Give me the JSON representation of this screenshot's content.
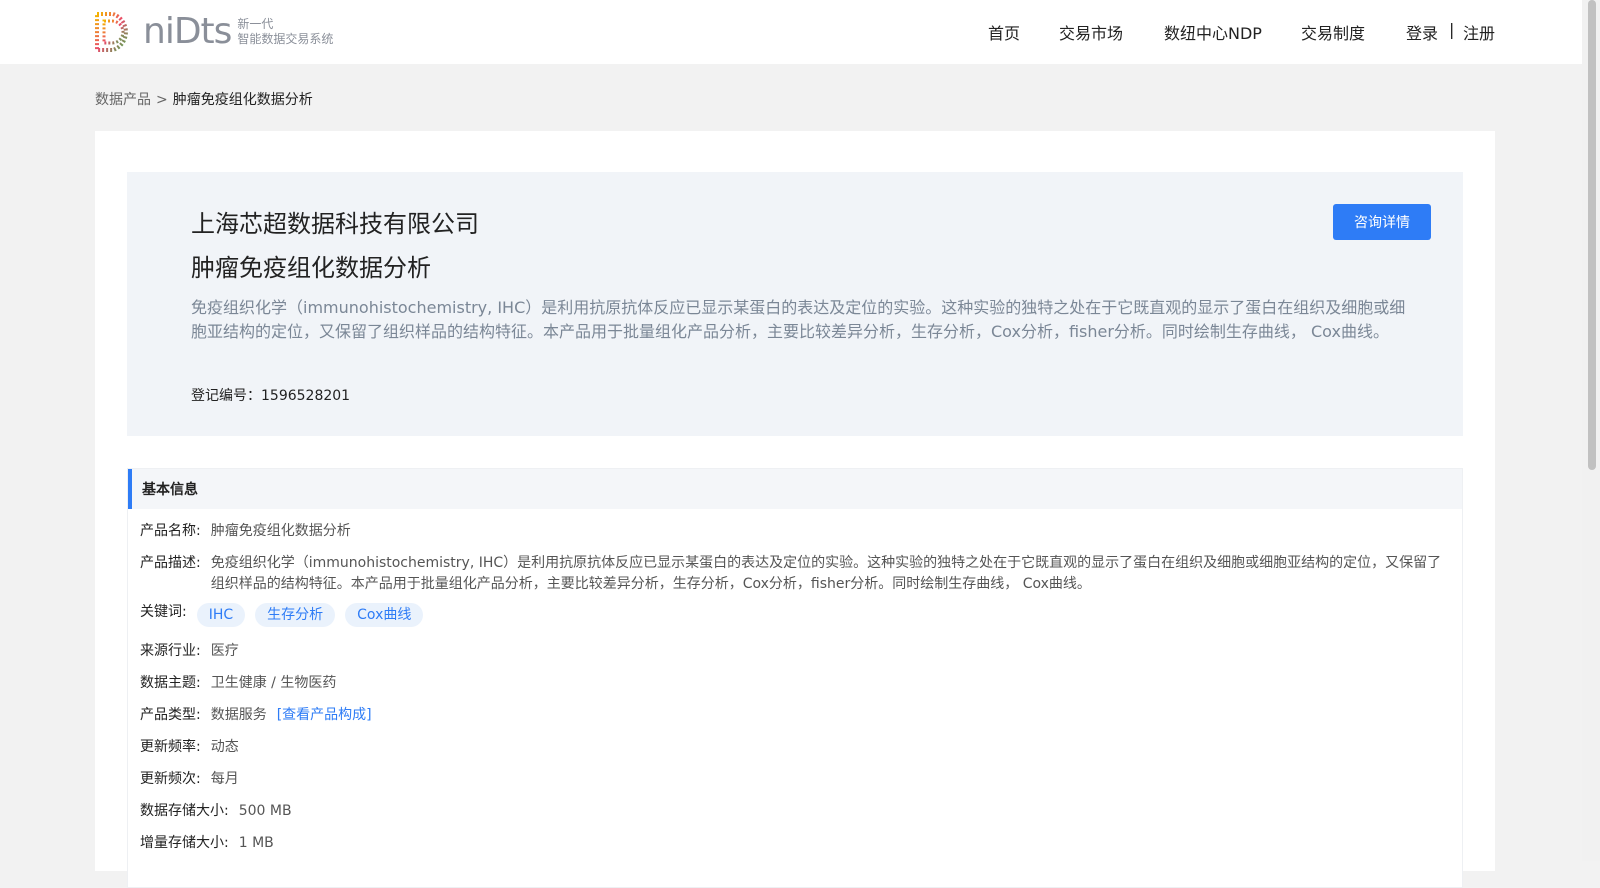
{
  "brand": {
    "name": "niDts",
    "tagline_line1": "新一代",
    "tagline_line2": "智能数据交易系统"
  },
  "nav": {
    "items": [
      "首页",
      "交易市场",
      "数纽中心NDP",
      "交易制度"
    ],
    "login": "登录",
    "separator": "|",
    "register": "注册"
  },
  "breadcrumb": {
    "parent": "数据产品",
    "separator": ">",
    "current": "肿瘤免疫组化数据分析"
  },
  "hero": {
    "company": "上海芯超数据科技有限公司",
    "product": "肿瘤免疫组化数据分析",
    "description": "免疫组织化学（immunohistochemistry, IHC）是利用抗原抗体反应已显示某蛋白的表达及定位的实验。这种实验的独特之处在于它既直观的显示了蛋白在组织及细胞或细胞亚结构的定位，又保留了组织样品的结构特征。本产品用于批量组化产品分析，主要比较差异分析，生存分析，Cox分析，fisher分析。同时绘制生存曲线， Cox曲线。",
    "registration": "登记编号：1596528201",
    "consult_button": "咨询详情"
  },
  "basic_info": {
    "title": "基本信息",
    "product_name_label": "产品名称:",
    "product_name": "肿瘤免疫组化数据分析",
    "description_label": "产品描述:",
    "description": "免疫组织化学（immunohistochemistry, IHC）是利用抗原抗体反应已显示某蛋白的表达及定位的实验。这种实验的独特之处在于它既直观的显示了蛋白在组织及细胞或细胞亚结构的定位，又保留了组织样品的结构特征。本产品用于批量组化产品分析，主要比较差异分析，生存分析，Cox分析，fisher分析。同时绘制生存曲线， Cox曲线。",
    "keywords_label": "关键词:",
    "keywords": [
      "IHC",
      "生存分析",
      "Cox曲线"
    ],
    "industry_label": "来源行业:",
    "industry": "医疗",
    "topic_label": "数据主题:",
    "topic": "卫生健康 / 生物医药",
    "type_label": "产品类型:",
    "type": "数据服务",
    "type_link": "[查看产品构成]",
    "update_rate_label": "更新频率:",
    "update_rate": "动态",
    "update_freq_label": "更新频次:",
    "update_freq": "每月",
    "storage_label": "数据存储大小:",
    "storage": "500 MB",
    "incremental_label": "增量存储大小:",
    "incremental": "1 MB"
  },
  "colors": {
    "accent": "#2e7cf6",
    "hero_bg": "#f1f4f8",
    "page_bg": "#f2f2f2"
  }
}
